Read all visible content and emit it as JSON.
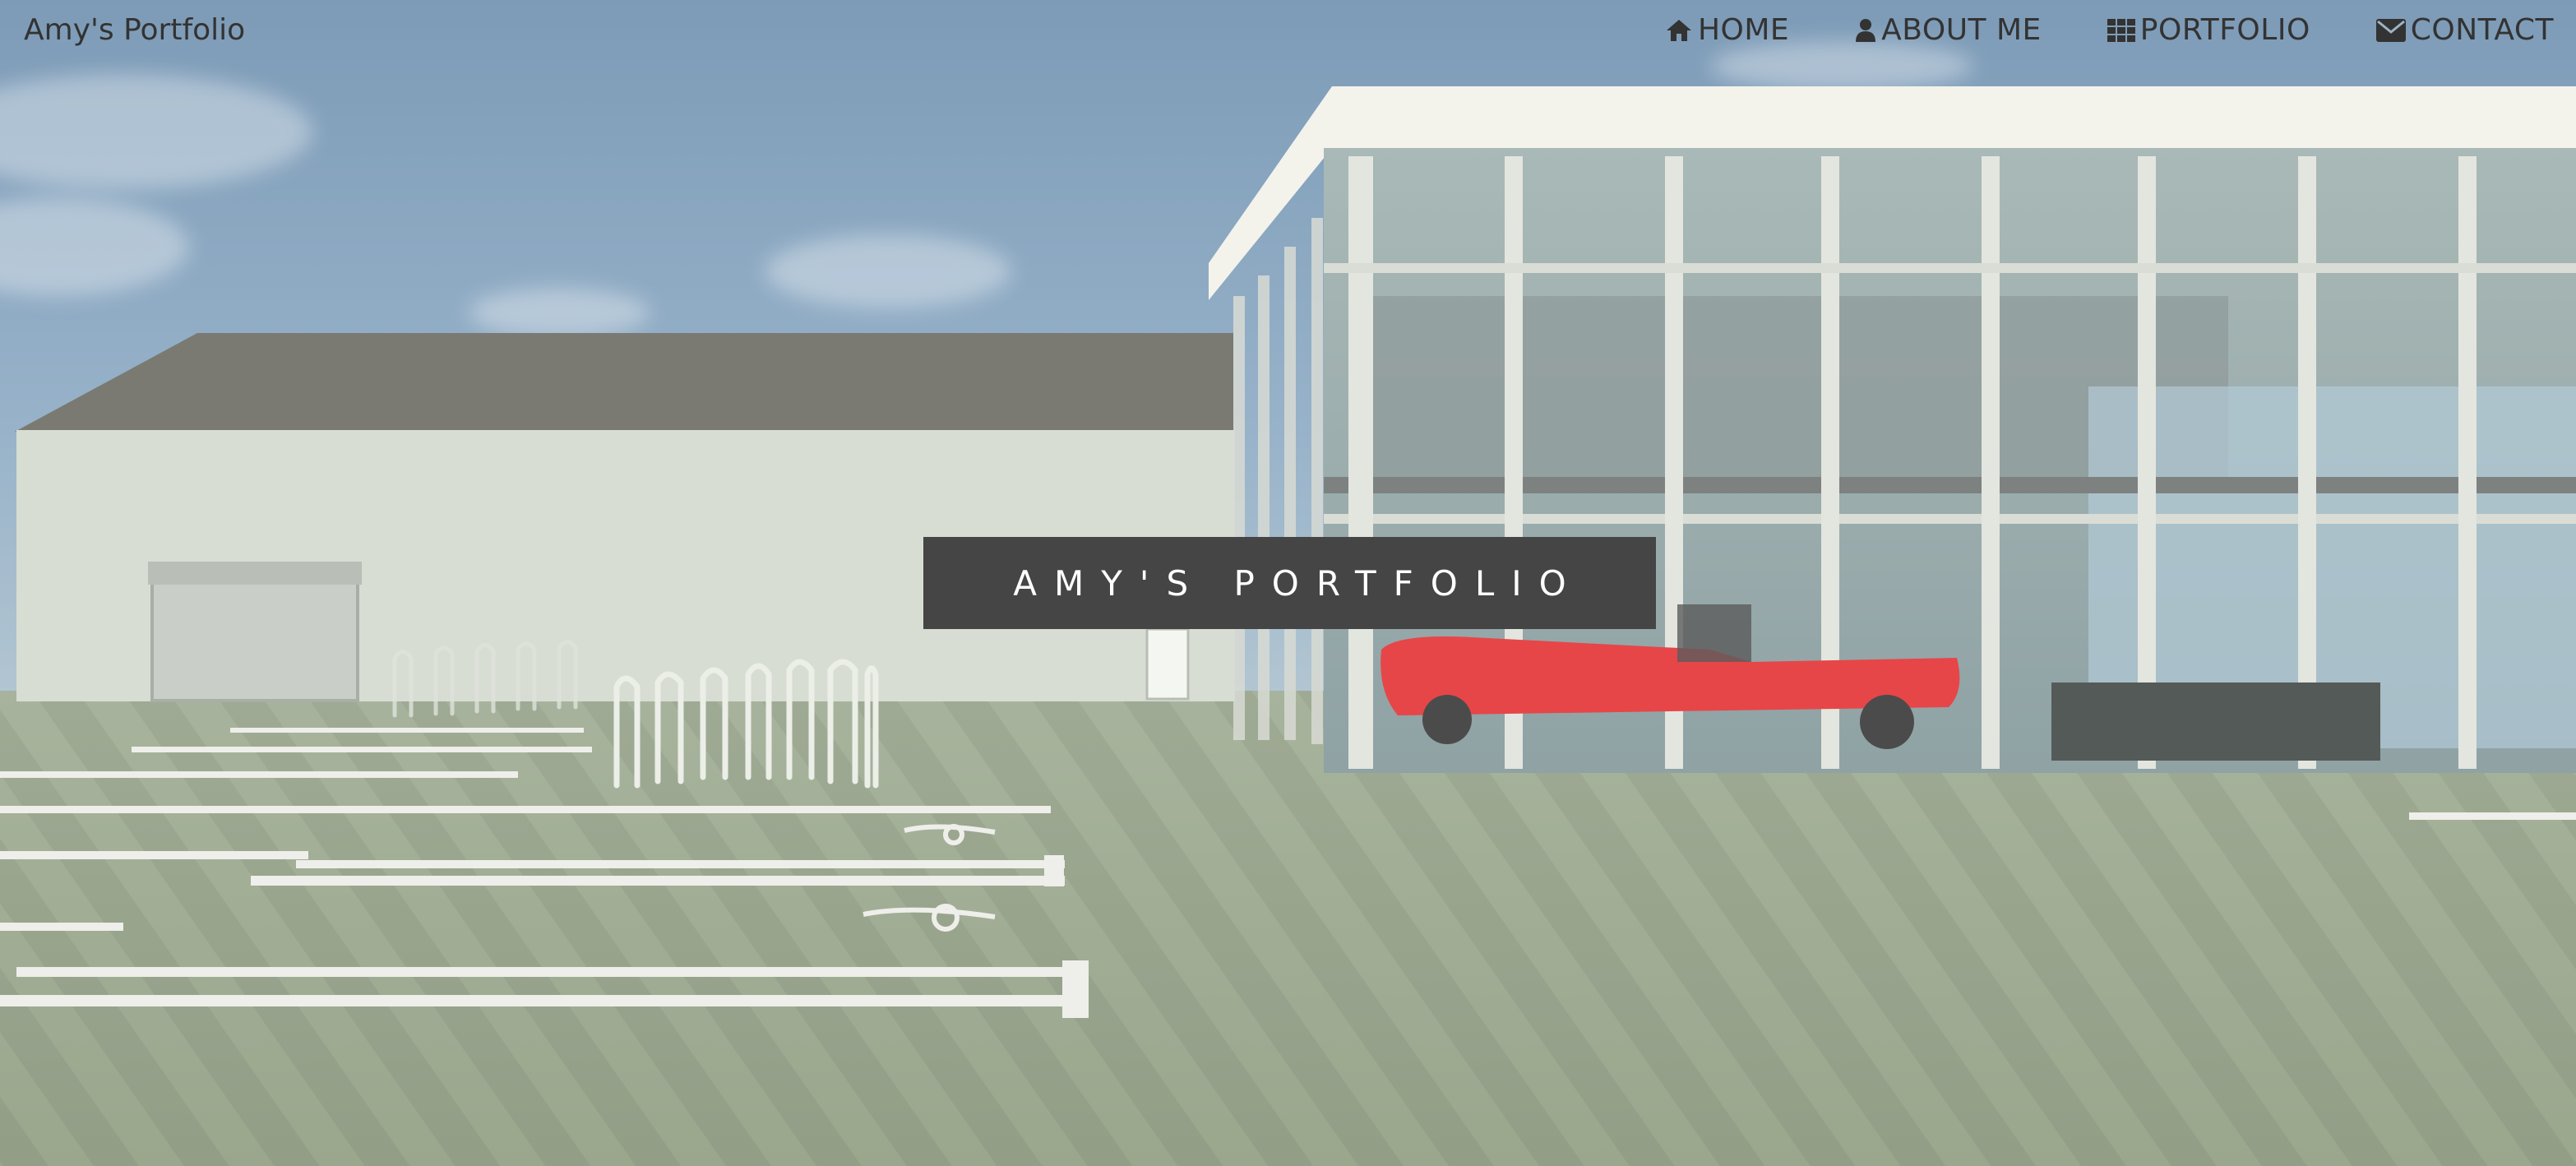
{
  "nav": {
    "brand": "Amy's Portfolio",
    "items": [
      {
        "label": "HOME",
        "icon": "home-icon"
      },
      {
        "label": "ABOUT ME",
        "icon": "user-icon"
      },
      {
        "label": "PORTFOLIO",
        "icon": "grid-icon"
      },
      {
        "label": "CONTACT",
        "icon": "envelope-icon"
      }
    ]
  },
  "hero": {
    "title": "AMY'S PORTFOLIO",
    "background": "3D rendering of a glass-walled car showroom with a red convertible, an adjoining warehouse, bike racks and a parking lot under a blue sky"
  },
  "colors": {
    "nav_text": "#333333",
    "title_box": "#454545",
    "title_text": "#ffffff"
  }
}
